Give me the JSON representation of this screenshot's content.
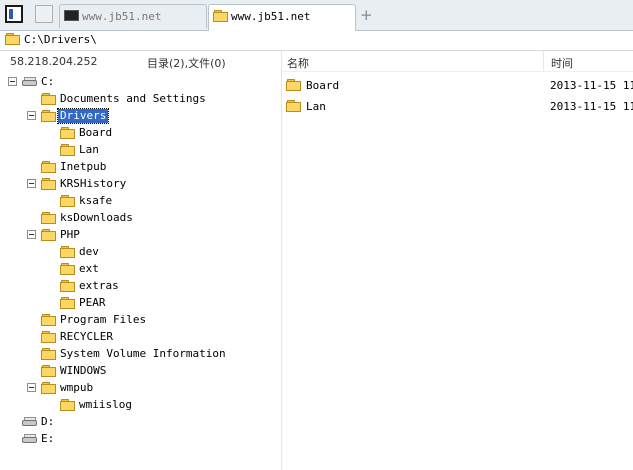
{
  "tabs": [
    {
      "label": "www.jb51.net",
      "active": false
    },
    {
      "label": "www.jb51.net",
      "active": true
    }
  ],
  "new_tab_label": "+",
  "path": "C:\\Drivers\\",
  "status": {
    "host": "58.218.204.252",
    "counts": "目录(2),文件(0)"
  },
  "columns": {
    "name": "名称",
    "time": "时间"
  },
  "tree": [
    {
      "label": "C:",
      "type": "drive",
      "level": 0,
      "expanded": true
    },
    {
      "label": "Documents and Settings",
      "type": "folder",
      "level": 1
    },
    {
      "label": "Drivers",
      "type": "folder",
      "level": 1,
      "expanded": true,
      "selected": true
    },
    {
      "label": "Board",
      "type": "folder",
      "level": 2
    },
    {
      "label": "Lan",
      "type": "folder",
      "level": 2
    },
    {
      "label": "Inetpub",
      "type": "folder",
      "level": 1
    },
    {
      "label": "KRSHistory",
      "type": "folder",
      "level": 1,
      "expanded": true
    },
    {
      "label": "ksafe",
      "type": "folder",
      "level": 2
    },
    {
      "label": "ksDownloads",
      "type": "folder",
      "level": 1
    },
    {
      "label": "PHP",
      "type": "folder",
      "level": 1,
      "expanded": true
    },
    {
      "label": "dev",
      "type": "folder",
      "level": 2
    },
    {
      "label": "ext",
      "type": "folder",
      "level": 2
    },
    {
      "label": "extras",
      "type": "folder",
      "level": 2
    },
    {
      "label": "PEAR",
      "type": "folder",
      "level": 2
    },
    {
      "label": "Program Files",
      "type": "folder",
      "level": 1
    },
    {
      "label": "RECYCLER",
      "type": "folder",
      "level": 1
    },
    {
      "label": "System Volume Information",
      "type": "folder",
      "level": 1
    },
    {
      "label": "WINDOWS",
      "type": "folder",
      "level": 1
    },
    {
      "label": "wmpub",
      "type": "folder",
      "level": 1,
      "expanded": true
    },
    {
      "label": "wmiislog",
      "type": "folder",
      "level": 2
    },
    {
      "label": "D:",
      "type": "drive",
      "level": 0
    },
    {
      "label": "E:",
      "type": "drive",
      "level": 0
    }
  ],
  "files": [
    {
      "name": "Board",
      "time": "2013-11-15 11:"
    },
    {
      "name": "Lan",
      "time": "2013-11-15 11:"
    }
  ],
  "icons": {
    "panel": "panel-toggle-icon",
    "folder": "folder-icon",
    "drive": "drive-icon",
    "console": "console-icon",
    "expander": "collapse-icon"
  },
  "colors": {
    "selection": "#3169c6",
    "folder": "#fbd764",
    "tabbar": "#e9eef3"
  }
}
